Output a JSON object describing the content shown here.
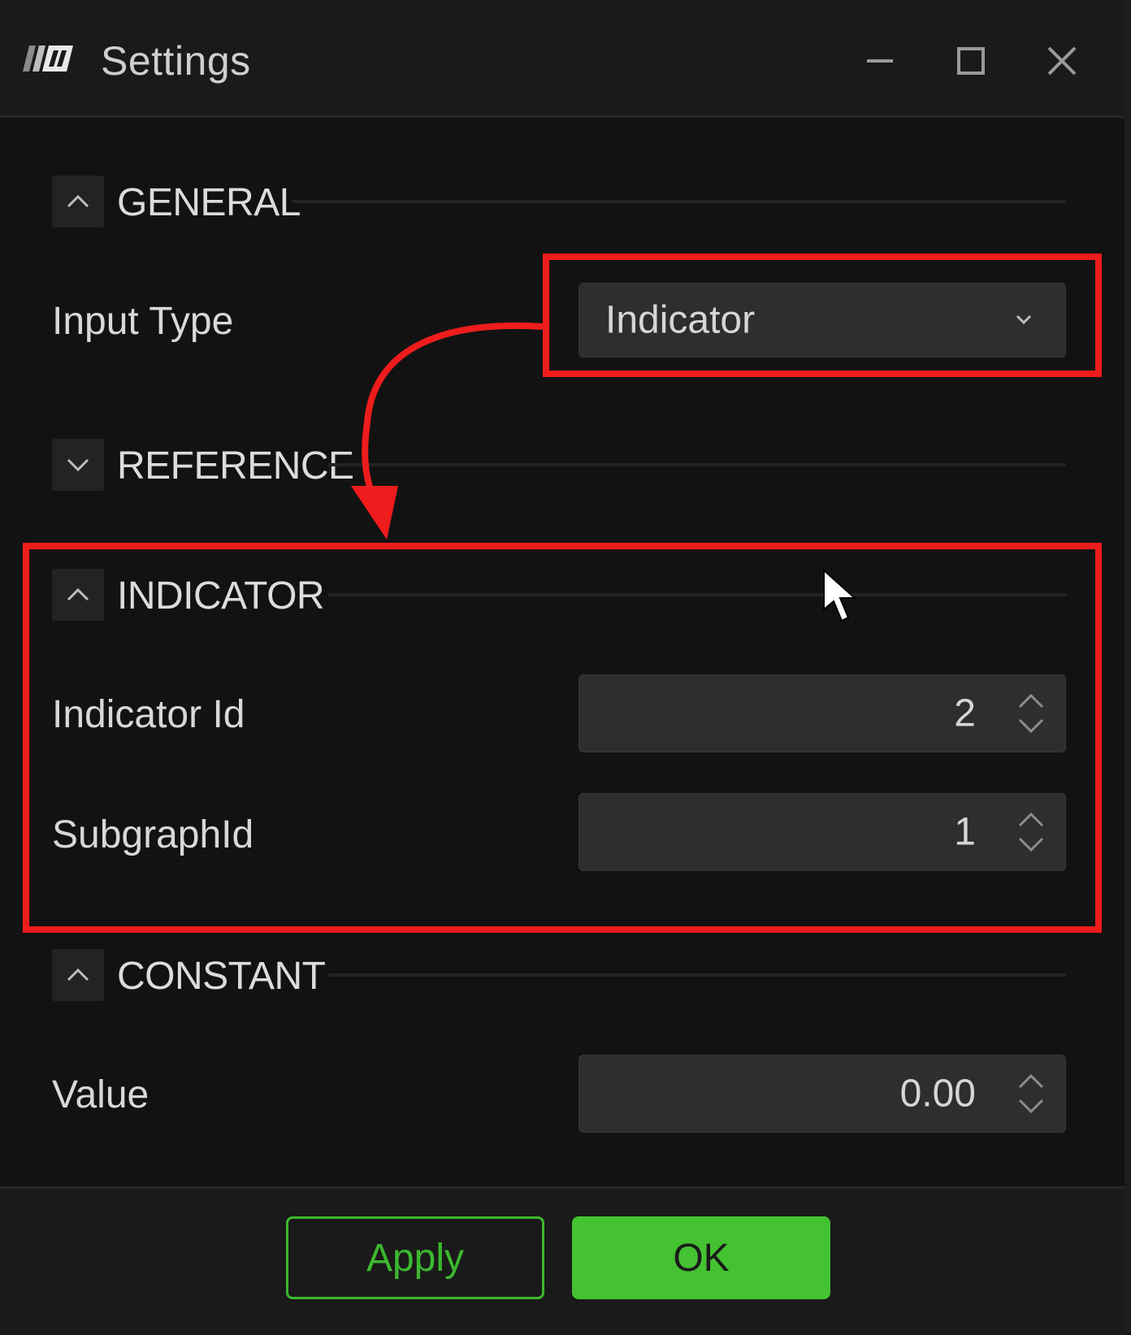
{
  "window": {
    "title": "Settings",
    "logo_icon": "app-logo-icon",
    "controls": [
      "minimize-icon",
      "maximize-icon",
      "close-icon"
    ]
  },
  "sections": {
    "general": {
      "label": "GENERAL",
      "state": "expanded"
    },
    "reference": {
      "label": "REFERENCE",
      "state": "collapsed"
    },
    "indicator": {
      "label": "INDICATOR",
      "state": "expanded"
    },
    "constant": {
      "label": "CONSTANT",
      "state": "expanded"
    }
  },
  "fields": {
    "input_type": {
      "label": "Input Type",
      "value": "Indicator"
    },
    "indicator_id": {
      "label": "Indicator Id",
      "value": "2"
    },
    "subgraph_id": {
      "label": "SubgraphId",
      "value": "1"
    },
    "value": {
      "label": "Value",
      "value": "0.00"
    }
  },
  "footer": {
    "apply_label": "Apply",
    "ok_label": "OK"
  },
  "colors": {
    "background": "#121212",
    "accent_green": "#44c232",
    "annotation_red": "#ee1c1c"
  }
}
